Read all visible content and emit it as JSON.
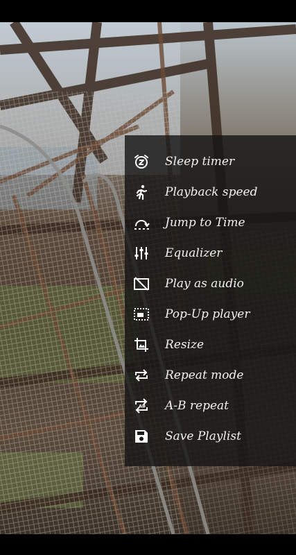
{
  "menu": {
    "items": [
      {
        "label": "Sleep timer",
        "icon": "alarm-clock-z-icon"
      },
      {
        "label": "Playback speed",
        "icon": "running-person-icon"
      },
      {
        "label": "Jump to Time",
        "icon": "jump-arc-icon"
      },
      {
        "label": "Equalizer",
        "icon": "equalizer-sliders-icon"
      },
      {
        "label": "Play as audio",
        "icon": "video-off-icon"
      },
      {
        "label": "Pop-Up player",
        "icon": "picture-in-picture-icon"
      },
      {
        "label": "Resize",
        "icon": "crop-icon"
      },
      {
        "label": "Repeat mode",
        "icon": "repeat-icon"
      },
      {
        "label": "A-B repeat",
        "icon": "ab-repeat-icon"
      },
      {
        "label": "Save Playlist",
        "icon": "save-floppy-icon"
      }
    ]
  },
  "colors": {
    "panel_background": "#141414",
    "menu_text": "#f2f2f2",
    "icon": "#ffffff"
  }
}
